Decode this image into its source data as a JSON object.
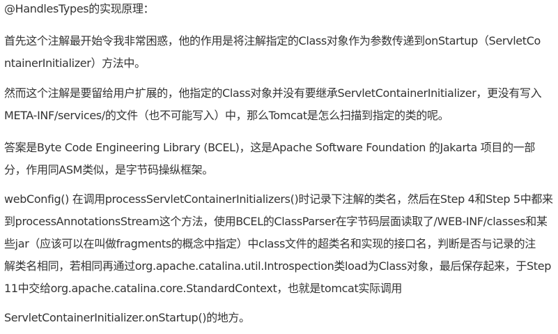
{
  "document": {
    "heading": "@HandlesTypes的实现原理：",
    "paragraphs": [
      {
        "lines": [
          "首先这个注解最开始令我非常困惑，他的作用是将注解指定的Class对象作为参数传递到onStartup（ServletCo",
          "ntainerInitializer）方法中。"
        ]
      },
      {
        "lines": [
          "然而这个注解是要留给用户扩展的，他指定的Class对象并没有要继承ServletContainerInitializer，更没有写入",
          "META-INF/services/的文件（也不可能写入）中，那么Tomcat是怎么扫描到指定的类的呢。"
        ]
      },
      {
        "lines": [
          "答案是Byte Code Engineering Library (BCEL)，这是Apache Software Foundation 的Jakarta 项目的一部",
          "分，作用同ASM类似，是字节码操纵框架。"
        ]
      },
      {
        "lines": [
          "webConfig() 在调用processServletContainerInitializers()时记录下注解的类名，然后在Step 4和Step 5中都来",
          "到processAnnotationsStream这个方法，使用BCEL的ClassParser在字节码层面读取了/WEB-INF/classes和某",
          "些jar（应该可以在叫做fragments的概念中指定）中class文件的超类名和实现的接口名，判断是否与记录的注",
          "解类名相同，若相同再通过org.apache.catalina.util.Introspection类load为Class对象，最后保存起来，于Step",
          "11中交给org.apache.catalina.core.StandardContext，也就是tomcat实际调用"
        ]
      }
    ],
    "closing": "ServletContainerInitializer.onStartup()的地方。"
  }
}
